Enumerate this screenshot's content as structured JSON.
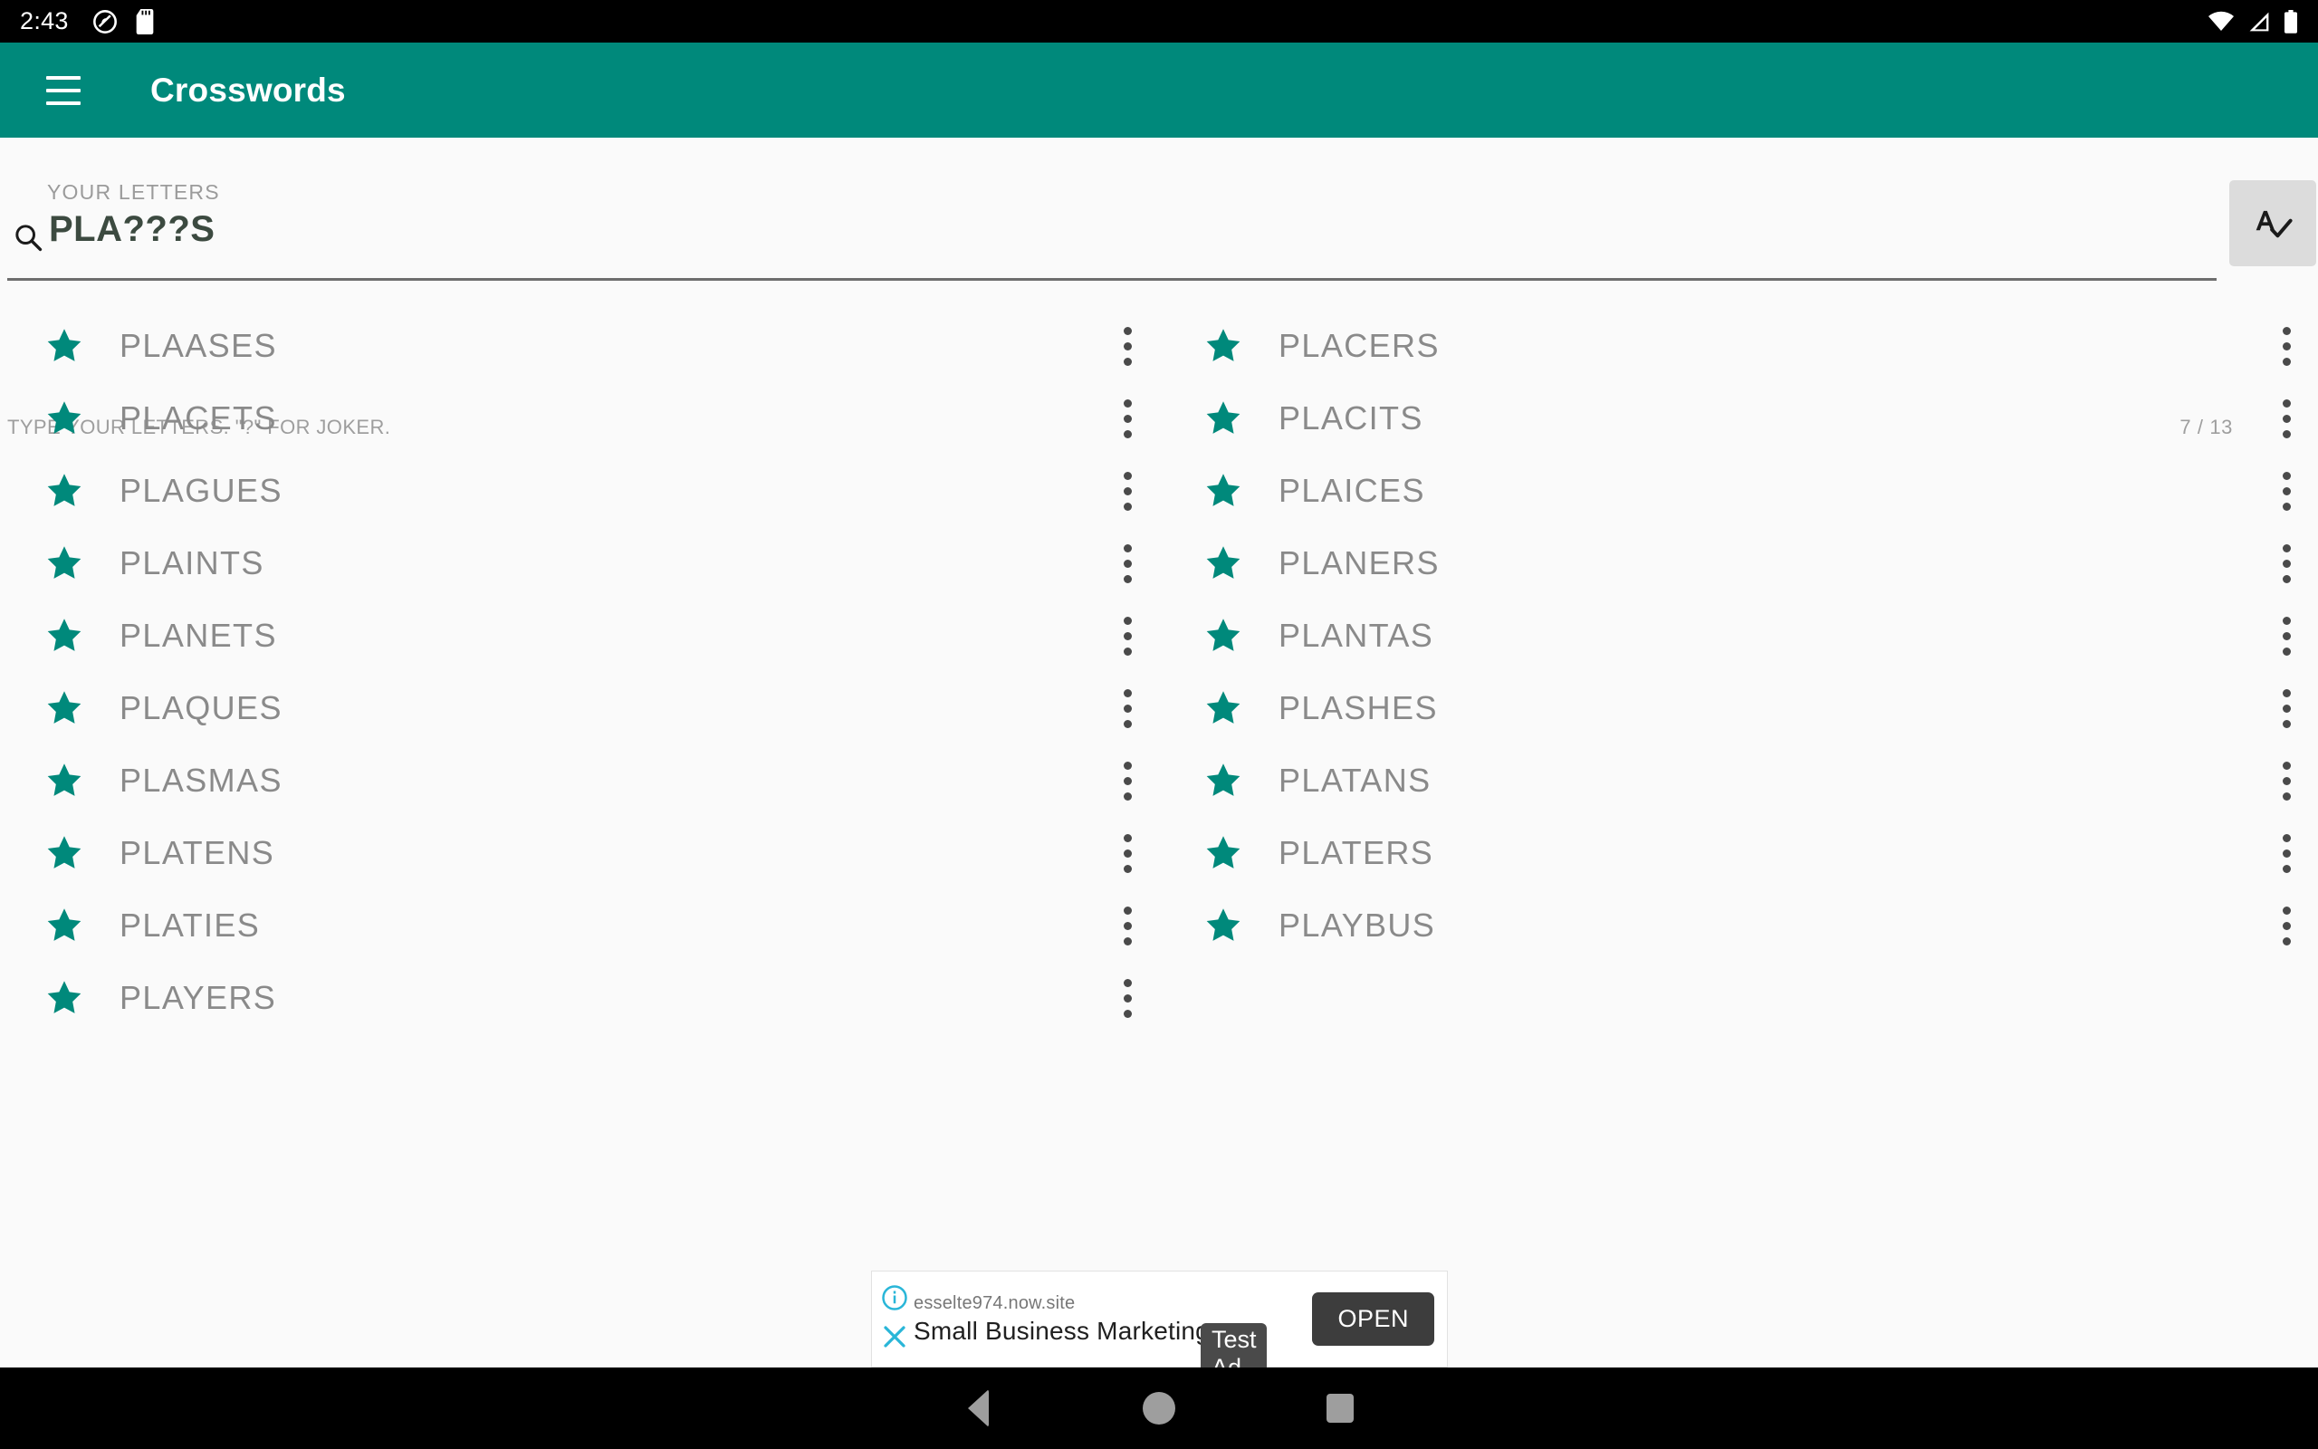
{
  "status_bar": {
    "clock": "2:43",
    "left_icons": [
      "dnd-icon",
      "sd-card-icon"
    ],
    "right_icons": [
      "wifi-icon",
      "cellular-signal-icon",
      "battery-icon"
    ]
  },
  "app_bar": {
    "menu_icon": "hamburger-menu-icon",
    "title": "Crosswords",
    "background": "#00897b"
  },
  "search": {
    "label": "YOUR LETTERS",
    "icon": "search-icon",
    "value": "PLA???S",
    "placeholder": "TYPE YOUR LETTERS",
    "hint": "TYPE YOUR LETTERS. \"?\" FOR JOKER.",
    "counter": "7 / 13",
    "spellcheck_icon": "spellcheck-icon"
  },
  "results": {
    "star_icon": "star-icon",
    "overflow_icon": "more-vertical-icon",
    "star_color": "#00897b",
    "left_column": [
      {
        "word": "PLAASES"
      },
      {
        "word": "PLACETS"
      },
      {
        "word": "PLAGUES"
      },
      {
        "word": "PLAINTS"
      },
      {
        "word": "PLANETS"
      },
      {
        "word": "PLAQUES"
      },
      {
        "word": "PLASMAS"
      },
      {
        "word": "PLATENS"
      },
      {
        "word": "PLATIES"
      },
      {
        "word": "PLAYERS"
      }
    ],
    "right_column": [
      {
        "word": "PLACERS"
      },
      {
        "word": "PLACITS"
      },
      {
        "word": "PLAICES"
      },
      {
        "word": "PLANERS"
      },
      {
        "word": "PLANTAS"
      },
      {
        "word": "PLASHES"
      },
      {
        "word": "PLATANS"
      },
      {
        "word": "PLATERS"
      },
      {
        "word": "PLAYBUS"
      }
    ]
  },
  "ad": {
    "info_icon": "info-circle-icon",
    "close_icon": "close-icon",
    "url": "esselte974.now.site",
    "title": "Small Business Marketing",
    "badge": "Test Ad",
    "cta": "OPEN"
  },
  "nav_bar": {
    "back_icon": "back-triangle-icon",
    "home_icon": "home-circle-icon",
    "recents_icon": "recents-square-icon"
  }
}
